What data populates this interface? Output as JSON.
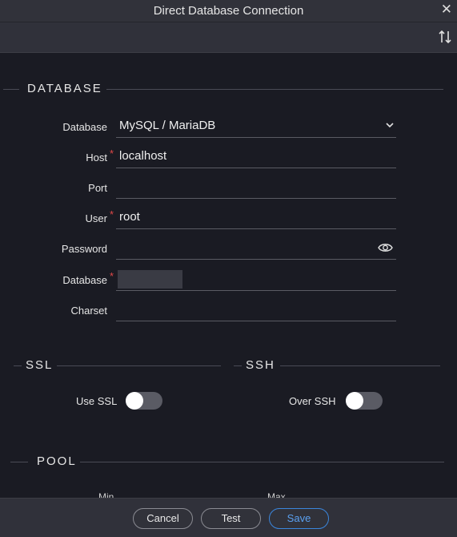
{
  "window": {
    "title": "Direct Database Connection"
  },
  "sections": {
    "database": "DATABASE",
    "ssl": "SSL",
    "ssh": "SSH",
    "pool": "POOL"
  },
  "fields": {
    "database_type": {
      "label": "Database",
      "value": "MySQL / MariaDB"
    },
    "host": {
      "label": "Host",
      "value": "localhost",
      "required": "*"
    },
    "port": {
      "label": "Port",
      "value": ""
    },
    "user": {
      "label": "User",
      "value": "root",
      "required": "*"
    },
    "password": {
      "label": "Password",
      "value": ""
    },
    "database_name": {
      "label": "Database",
      "value": "",
      "required": "*"
    },
    "charset": {
      "label": "Charset",
      "value": ""
    }
  },
  "ssl": {
    "use_ssl_label": "Use SSL",
    "use_ssl_on": false
  },
  "ssh": {
    "over_ssh_label": "Over SSH",
    "over_ssh_on": false
  },
  "pool": {
    "min_label": "Min",
    "max_label": "Max"
  },
  "footer": {
    "cancel": "Cancel",
    "test": "Test",
    "save": "Save"
  },
  "colors": {
    "background": "#1a1b23",
    "required": "#e04848",
    "primary": "#3b86dc"
  },
  "icons": {
    "close": "close-icon",
    "sort": "sort-icon",
    "chevron": "chevron-down-icon",
    "eye": "eye-icon"
  }
}
